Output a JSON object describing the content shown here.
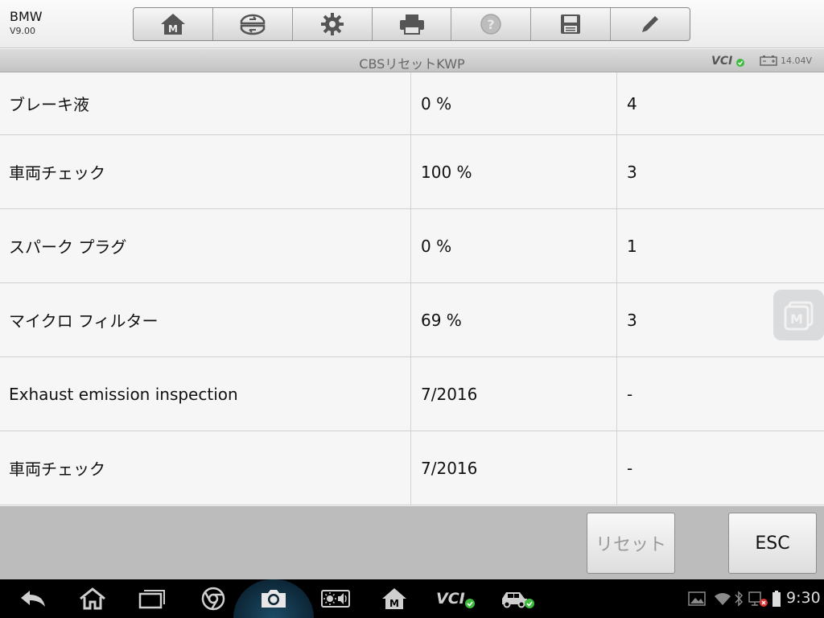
{
  "app": {
    "name": "BMW",
    "version": "V9.00"
  },
  "toolbar": {
    "buttons": [
      {
        "icon": "home-m-icon"
      },
      {
        "icon": "vehicle-swap-icon"
      },
      {
        "icon": "gear-icon"
      },
      {
        "icon": "printer-icon"
      },
      {
        "icon": "help-icon"
      },
      {
        "icon": "save-icon"
      },
      {
        "icon": "pencil-icon"
      }
    ]
  },
  "titlebar": {
    "title": "CBSリセットKWP",
    "vci": "VCI",
    "voltage": "14.04V"
  },
  "table": {
    "rows": [
      {
        "name": "ブレーキ液",
        "status": "0 %",
        "count": "4"
      },
      {
        "name": "車両チェック",
        "status": "100 %",
        "count": "3"
      },
      {
        "name": "スパーク プラグ",
        "status": "0 %",
        "count": "1"
      },
      {
        "name": "マイクロ フィルター",
        "status": "69 %",
        "count": "3"
      },
      {
        "name": "Exhaust emission inspection",
        "status": "7/2016",
        "count": "-"
      },
      {
        "name": "車両チェック",
        "status": "7/2016",
        "count": "-"
      }
    ]
  },
  "actions": {
    "reset_label": "リセット",
    "esc_label": "ESC"
  },
  "system": {
    "time": "9:30",
    "vci_label": "VCI"
  },
  "colors": {
    "accent_green": "#3dbb3d",
    "title_text": "#666666"
  }
}
